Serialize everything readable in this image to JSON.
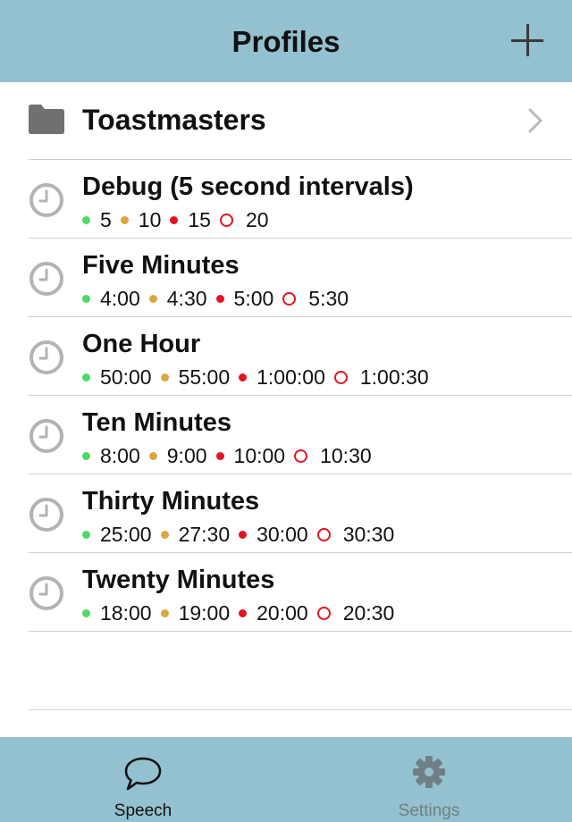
{
  "navbar": {
    "title": "Profiles",
    "add_icon": "plus-icon"
  },
  "folder": {
    "label": "Toastmasters",
    "icon": "folder-icon",
    "chevron_icon": "chevron-right-icon"
  },
  "profiles": [
    {
      "name": "Debug (5 second intervals)",
      "green": "5",
      "yellow": "10",
      "red": "15",
      "over": "20"
    },
    {
      "name": "Five Minutes",
      "green": "4:00",
      "yellow": "4:30",
      "red": "5:00",
      "over": "5:30"
    },
    {
      "name": "One Hour",
      "green": "50:00",
      "yellow": "55:00",
      "red": "1:00:00",
      "over": "1:00:30"
    },
    {
      "name": "Ten Minutes",
      "green": "8:00",
      "yellow": "9:00",
      "red": "10:00",
      "over": "10:30"
    },
    {
      "name": "Thirty Minutes",
      "green": "25:00",
      "yellow": "27:30",
      "red": "30:00",
      "over": "30:30"
    },
    {
      "name": "Twenty Minutes",
      "green": "18:00",
      "yellow": "19:00",
      "red": "20:00",
      "over": "20:30"
    }
  ],
  "tabs": {
    "speech": {
      "label": "Speech",
      "icon": "speech-bubble-icon"
    },
    "settings": {
      "label": "Settings",
      "icon": "gear-icon"
    }
  },
  "colors": {
    "bar": "#94c1cf",
    "green": "#4cd964",
    "yellow": "#dba63c",
    "red": "#e3141f"
  }
}
